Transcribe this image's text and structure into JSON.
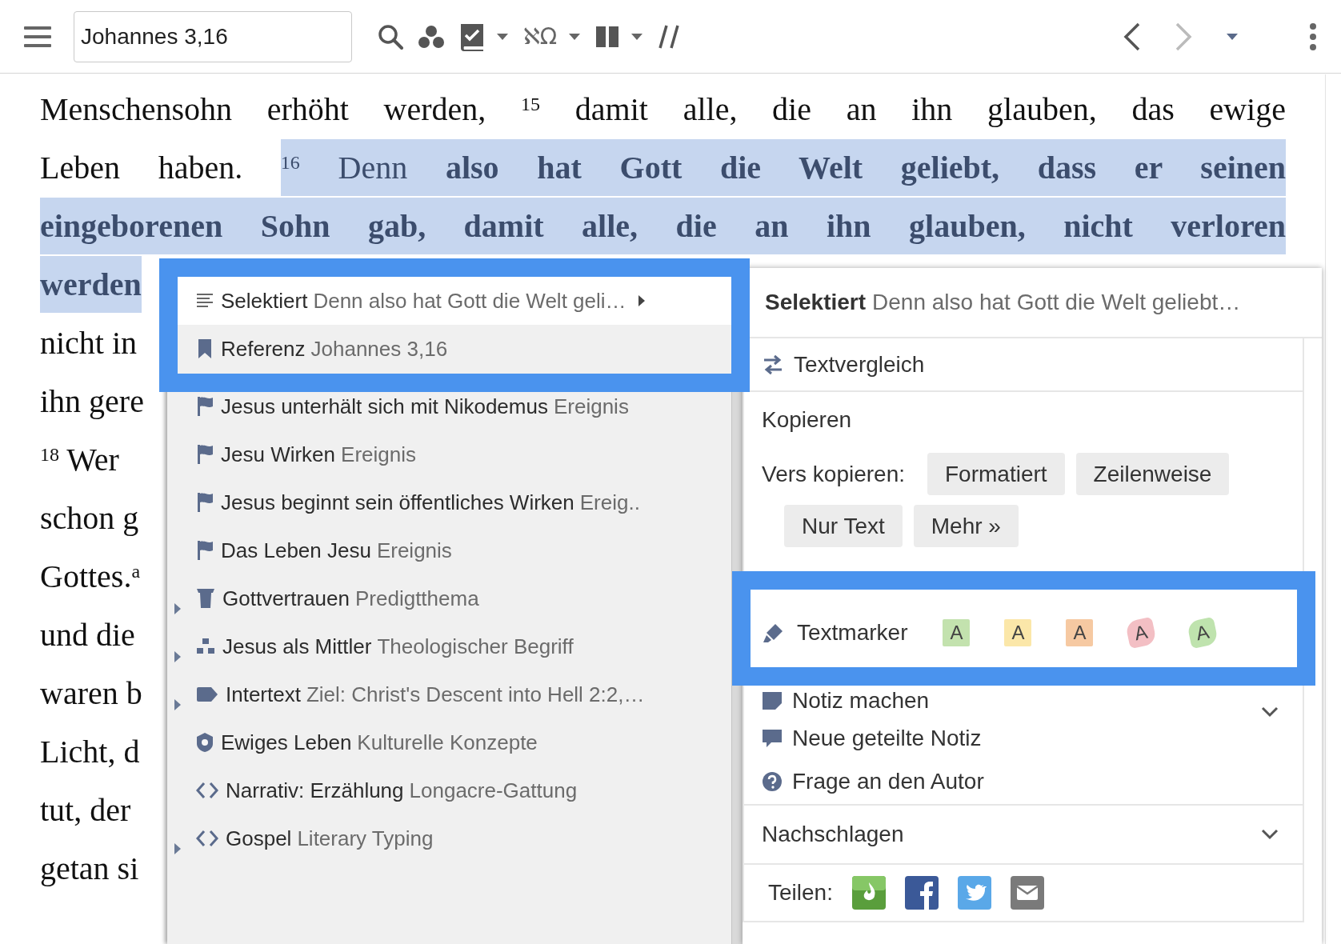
{
  "toolbar": {
    "search": {
      "value": "Johannes 3,16"
    },
    "language_glyphs": "ℵΩ",
    "back_disabled": false,
    "forward_disabled": true
  },
  "passage": {
    "lines": [
      {
        "justified": true,
        "segments": [
          {
            "text": "Menschensohn erhöht werden, $^{15}$ damit alle, die an ihn glauben, das ewige",
            "highlighted": false,
            "bold": false
          }
        ]
      },
      {
        "justified": true,
        "segments": [
          {
            "text": "Leben haben.",
            "highlighted": false,
            "bold": false
          },
          {
            "text": "$^{16}$ Denn **also hat Gott die Welt geliebt, dass er seinen**",
            "highlighted": true,
            "bold": false
          }
        ]
      },
      {
        "justified": true,
        "segments": [
          {
            "text": "eingeborenen Sohn gab, damit alle, die an ihn glauben, nicht verloren",
            "highlighted": true,
            "bold": true
          }
        ]
      },
      {
        "segments": [
          {
            "text": "werden",
            "highlighted": true,
            "bold": true
          }
        ]
      },
      {
        "segments": [
          {
            "text": "nicht in",
            "highlighted": false,
            "bold": false
          }
        ]
      },
      {
        "segments": [
          {
            "text": "ihn gere",
            "highlighted": false,
            "bold": false
          }
        ]
      },
      {
        "segments": [
          {
            "text": "$^{18}$ Wer",
            "highlighted": false,
            "bold": false
          }
        ]
      },
      {
        "segments": [
          {
            "text": "schon g",
            "highlighted": false,
            "bold": false
          }
        ]
      },
      {
        "segments": [
          {
            "text": "Gottes.$^{a}$",
            "highlighted": false,
            "bold": false
          }
        ]
      },
      {
        "segments": [
          {
            "text": "und die",
            "highlighted": false,
            "bold": false
          }
        ]
      },
      {
        "segments": [
          {
            "text": "waren b",
            "highlighted": false,
            "bold": false
          }
        ]
      },
      {
        "segments": [
          {
            "text": "Licht, d",
            "highlighted": false,
            "bold": false
          }
        ]
      },
      {
        "segments": [
          {
            "text": "tut, der",
            "highlighted": false,
            "bold": false
          }
        ]
      },
      {
        "segments": [
          {
            "text": "getan si",
            "highlighted": false,
            "bold": false
          }
        ]
      }
    ]
  },
  "context_menu": {
    "items": [
      {
        "kind": "selection",
        "title": "Selektiert",
        "detail": "Denn also hat Gott die Welt geli…",
        "submenu": true,
        "selected": true
      },
      {
        "kind": "reference",
        "title": "Referenz",
        "detail": "Johannes 3,16",
        "submenu": false,
        "selected": false
      },
      {
        "kind": "event",
        "title": "Jesus unterhält sich mit Nikodemus",
        "detail": "Ereignis",
        "expandable": false,
        "submenu": false,
        "selected": false
      },
      {
        "kind": "event",
        "title": "Jesu Wirken",
        "detail": "Ereignis",
        "expandable": false,
        "submenu": false,
        "selected": false
      },
      {
        "kind": "event",
        "title": "Jesus beginnt sein öffentliches Wirken",
        "detail": "Ereig..",
        "expandable": false,
        "submenu": false,
        "selected": false
      },
      {
        "kind": "event",
        "title": "Das Leben Jesu",
        "detail": "Ereignis",
        "expandable": false,
        "submenu": false,
        "selected": false
      },
      {
        "kind": "sermon-topic",
        "title": "Gottvertrauen",
        "detail": "Predigtthema",
        "expandable": true,
        "submenu": false,
        "selected": false
      },
      {
        "kind": "concept",
        "title": "Jesus als Mittler",
        "detail": "Theologischer Begriff",
        "expandable": true,
        "submenu": false,
        "selected": false
      },
      {
        "kind": "intertext",
        "title": "Intertext",
        "detail": "Ziel: Christ's Descent into Hell 2:2,…",
        "expandable": true,
        "submenu": false,
        "selected": false
      },
      {
        "kind": "culture",
        "title": "Ewiges Leben",
        "detail": "Kulturelle Konzepte",
        "expandable": false,
        "submenu": false,
        "selected": false
      },
      {
        "kind": "genre",
        "title": "Narrativ: Erzählung",
        "detail": "Longacre-Gattung",
        "expandable": false,
        "submenu": false,
        "selected": false
      },
      {
        "kind": "genre",
        "title": "Gospel",
        "detail": "Literary Typing",
        "expandable": true,
        "submenu": false,
        "selected": false
      }
    ]
  },
  "action_panel": {
    "header": {
      "title": "Selektiert",
      "detail": "Denn also hat Gott die Welt geliebt…"
    },
    "compare": "Textvergleich",
    "copy": {
      "title": "Kopieren",
      "label": "Vers kopieren:",
      "buttons": [
        "Formatiert",
        "Zeilenweise",
        "Nur Text",
        "Mehr »"
      ]
    },
    "highlighter": {
      "label": "Textmarker",
      "swatches": [
        {
          "letter": "A",
          "kind": "box",
          "color": "#c3e2ae"
        },
        {
          "letter": "A",
          "kind": "box",
          "color": "#fbe7a9"
        },
        {
          "letter": "A",
          "kind": "box",
          "color": "#f6c9a2"
        },
        {
          "letter": "A",
          "kind": "brush",
          "color": "#f3bfc4"
        },
        {
          "letter": "A",
          "kind": "brush",
          "color": "#bfe3ae"
        }
      ]
    },
    "note": "Notiz machen",
    "items": [
      {
        "kind": "shared-note",
        "label": "Neue geteilte Notiz"
      },
      {
        "kind": "question",
        "label": "Frage an den Autor"
      }
    ],
    "lookup": "Nachschlagen",
    "share": {
      "label": "Teilen:",
      "targets": [
        {
          "kind": "faithlife"
        },
        {
          "kind": "facebook"
        },
        {
          "kind": "twitter"
        },
        {
          "kind": "email"
        }
      ]
    }
  }
}
